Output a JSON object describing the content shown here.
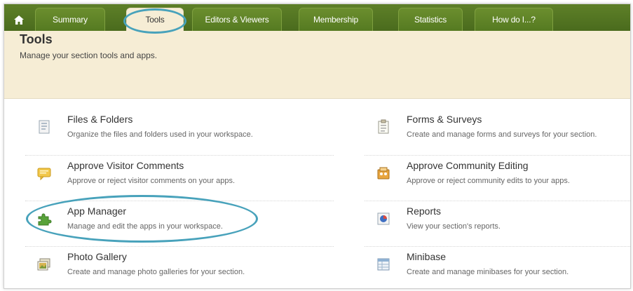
{
  "nav": {
    "home_icon": "home-icon",
    "tabs": [
      {
        "label": "Summary",
        "active": false
      },
      {
        "label": "Tools",
        "active": true
      },
      {
        "label": "Editors & Viewers",
        "active": false
      },
      {
        "label": "Membership",
        "active": false
      },
      {
        "label": "Statistics",
        "active": false
      },
      {
        "label": "How do I...?",
        "active": false
      }
    ]
  },
  "header": {
    "title": "Tools",
    "subtitle": "Manage your section tools and apps."
  },
  "tools": [
    {
      "name": "Files & Folders",
      "description": "Organize the files and folders used in your workspace.",
      "icon": "files-folders-icon"
    },
    {
      "name": "Forms & Surveys",
      "description": "Create and manage forms and surveys for your section.",
      "icon": "forms-surveys-icon"
    },
    {
      "name": "Approve Visitor Comments",
      "description": "Approve or reject visitor comments on your apps.",
      "icon": "comments-icon"
    },
    {
      "name": "Approve Community Editing",
      "description": "Approve or reject community edits to your apps.",
      "icon": "community-editing-icon"
    },
    {
      "name": "App Manager",
      "description": "Manage and edit the apps in your workspace.",
      "icon": "puzzle-icon"
    },
    {
      "name": "Reports",
      "description": "View your section's reports.",
      "icon": "reports-icon"
    },
    {
      "name": "Photo Gallery",
      "description": "Create and manage photo galleries for your section.",
      "icon": "photo-gallery-icon"
    },
    {
      "name": "Minibase",
      "description": "Create and manage minibases for your section.",
      "icon": "minibase-icon"
    }
  ],
  "colors": {
    "nav_green": "#4a6b1d",
    "header_beige": "#f6edd5",
    "highlight_ring": "#48a2bb"
  }
}
